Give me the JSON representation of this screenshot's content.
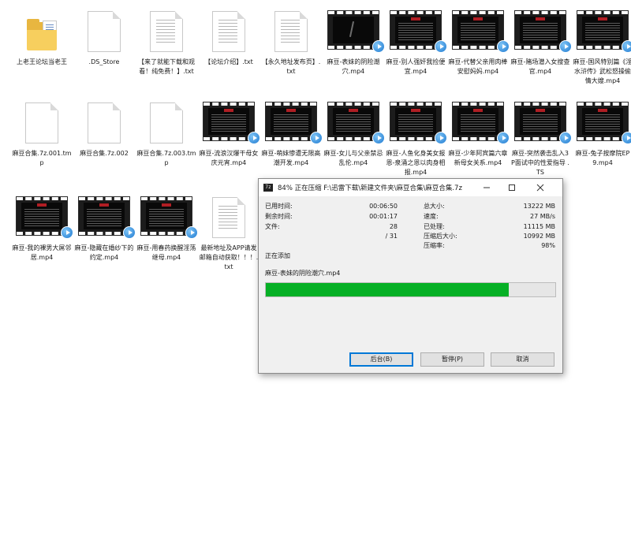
{
  "desktop": {
    "files": [
      {
        "name": "上老王论坛当老王",
        "type": "folder"
      },
      {
        "name": ".DS_Store",
        "type": "document-blank"
      },
      {
        "name": "【来了就能下载和观看！纯免费！】.txt",
        "type": "text"
      },
      {
        "name": "【论坛介绍】.txt",
        "type": "text"
      },
      {
        "name": "【永久地址发布页】.txt",
        "type": "text"
      },
      {
        "name": "麻豆-表妹的阴险潮穴.mp4",
        "type": "video-dark"
      },
      {
        "name": "麻豆-别人强奸我捡便宜.mp4",
        "type": "video"
      },
      {
        "name": "麻豆-代替父亲用肉棒安慰妈妈.mp4",
        "type": "video"
      },
      {
        "name": "麻豆-赌场潜入女搜查官.mp4",
        "type": "video"
      },
      {
        "name": "麻豆-国风特别篇《淫水浒传》武松怒操偷情大嫂.mp4",
        "type": "video"
      },
      {
        "name": "麻豆合集.7z.001.tmp",
        "type": "document-blank"
      },
      {
        "name": "麻豆合集.7z.002",
        "type": "document-blank"
      },
      {
        "name": "麻豆合集.7z.003.tmp",
        "type": "document-blank"
      },
      {
        "name": "麻豆-流浪汉爆干母女庆元宵.mp4",
        "type": "video"
      },
      {
        "name": "麻豆-萌妹惨遭无限高潮开发.mp4",
        "type": "video"
      },
      {
        "name": "麻豆-女儿与父亲禁忌乱伦.mp4",
        "type": "video"
      },
      {
        "name": "麻豆-人鱼化身美女报恩-泉涌之恩以肉身相报.mp4",
        "type": "video"
      },
      {
        "name": "麻豆-少年阿宾篇六章 新母女关系.mp4",
        "type": "video"
      },
      {
        "name": "麻豆-突然袭击乱入3P面试中的性爱指导 .TS",
        "type": "video"
      },
      {
        "name": "麻豆-兔子按摩院EP9.mp4",
        "type": "video"
      },
      {
        "name": "麻豆-我的裸男大屌邻居.mp4",
        "type": "video"
      },
      {
        "name": "麻豆-隐藏在婚纱下的约定.mp4",
        "type": "video"
      },
      {
        "name": "麻豆-用春药换醒淫荡继母.mp4",
        "type": "video"
      },
      {
        "name": "最新地址及APP请发邮箱自动获取！！！.txt",
        "type": "text"
      }
    ]
  },
  "dialog": {
    "app_icon": "7z",
    "title": "84% 正在压缩 F:\\迅雷下载\\新建文件夹\\麻豆合集\\麻豆合集.7z",
    "stats_left": [
      {
        "label": "已用时间:",
        "value": "00:06:50"
      },
      {
        "label": "剩余时间:",
        "value": "00:01:17"
      },
      {
        "label": "文件:",
        "value": "28"
      },
      {
        "label": "",
        "value": "/ 31"
      }
    ],
    "stats_right": [
      {
        "label": "总大小:",
        "value": "13222 MB"
      },
      {
        "label": "速度:",
        "value": "27 MB/s"
      },
      {
        "label": "已处理:",
        "value": "11115 MB"
      },
      {
        "label": "压缩后大小:",
        "value": "10992 MB"
      },
      {
        "label": "压缩率:",
        "value": "98%"
      }
    ],
    "status": "正在添加",
    "current_file": "麻豆-表妹的阴险潮穴.mp4",
    "progress_percent": 84,
    "buttons": {
      "background": "后台(B)",
      "pause": "暂停(P)",
      "cancel": "取消"
    },
    "progress_color": "#06b025"
  }
}
